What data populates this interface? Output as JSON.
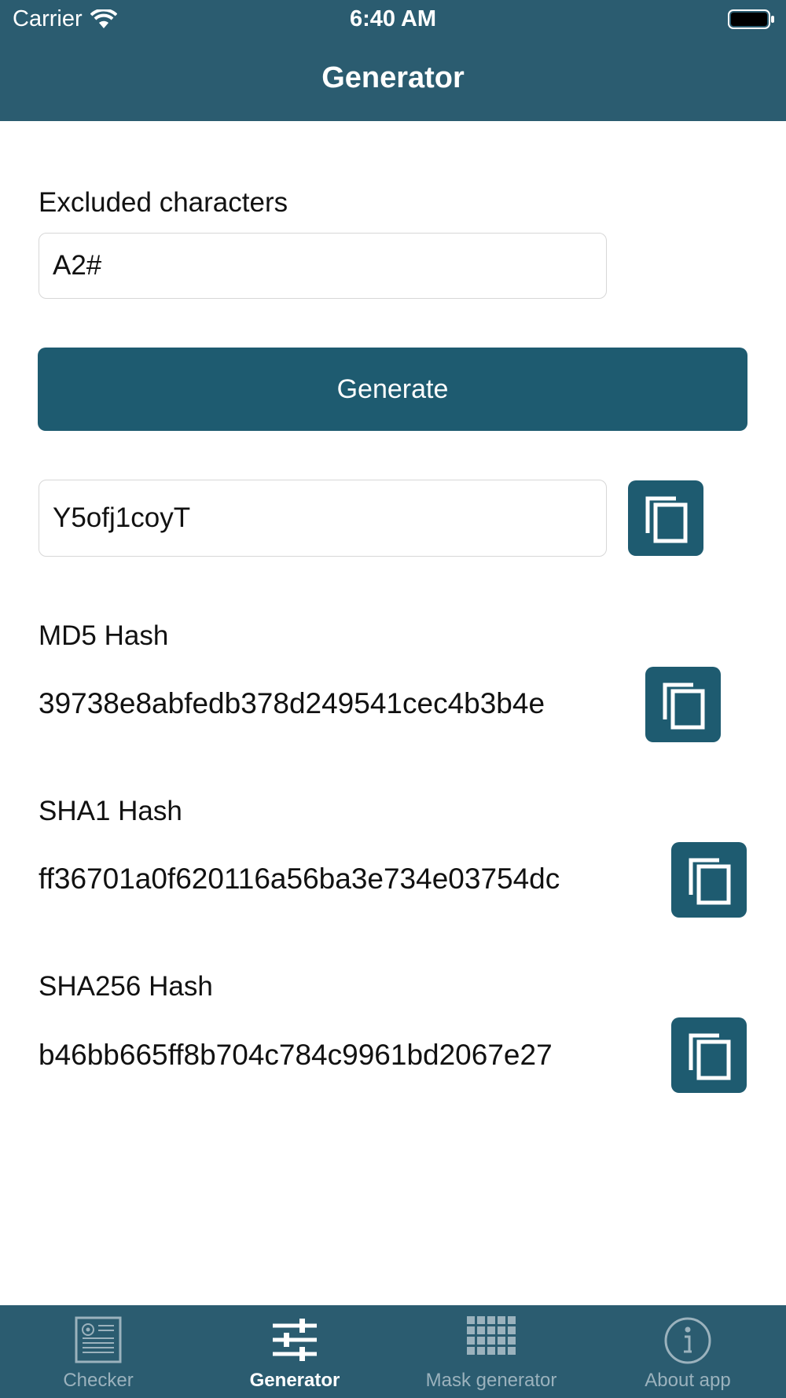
{
  "status_bar": {
    "carrier": "Carrier",
    "time": "6:40 AM"
  },
  "nav": {
    "title": "Generator"
  },
  "excluded": {
    "label": "Excluded characters",
    "value": "A2#"
  },
  "generate_button": {
    "label": "Generate"
  },
  "password": {
    "value": "Y5ofj1coyT"
  },
  "hashes": {
    "md5": {
      "label": "MD5 Hash",
      "value": "39738e8abfedb378d249541cec4b3b4e"
    },
    "sha1": {
      "label": "SHA1 Hash",
      "value": "ff36701a0f620116a56ba3e734e03754dc"
    },
    "sha256": {
      "label": "SHA256 Hash",
      "value": "b46bb665ff8b704c784c9961bd2067e27"
    }
  },
  "tabs": [
    {
      "label": "Checker",
      "icon": "document-icon",
      "active": false
    },
    {
      "label": "Generator",
      "icon": "sliders-icon",
      "active": true
    },
    {
      "label": "Mask generator",
      "icon": "grid-icon",
      "active": false
    },
    {
      "label": "About app",
      "icon": "info-icon",
      "active": false
    }
  ],
  "colors": {
    "header": "#2b5c70",
    "button": "#1e5b70",
    "tab_inactive": "#9bb2bd"
  }
}
